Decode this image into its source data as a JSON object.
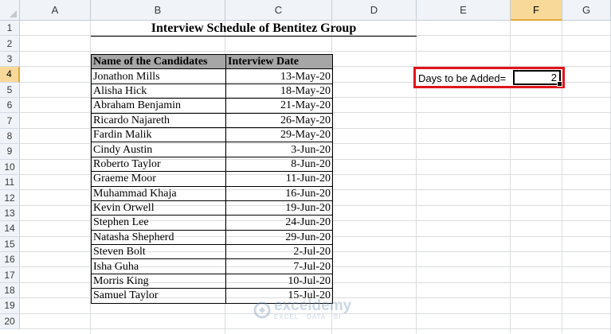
{
  "sheet": {
    "columns": [
      "A",
      "B",
      "C",
      "D",
      "E",
      "F",
      "G"
    ],
    "active_column": "F",
    "rows": [
      "1",
      "2",
      "3",
      "4",
      "5",
      "6",
      "7",
      "8",
      "9",
      "10",
      "11",
      "12",
      "13",
      "14",
      "15",
      "16",
      "17",
      "18",
      "19",
      "20"
    ],
    "active_row": "4"
  },
  "title": "Interview Schedule of Bentitez Group",
  "table": {
    "headers": [
      "Name of the Candidates",
      "Interview Date"
    ],
    "rows": [
      {
        "name": "Jonathon Mills",
        "date": "13-May-20"
      },
      {
        "name": "Alisha Hick",
        "date": "18-May-20"
      },
      {
        "name": "Abraham Benjamin",
        "date": "21-May-20"
      },
      {
        "name": "Ricardo Najareth",
        "date": "26-May-20"
      },
      {
        "name": "Fardin Malik",
        "date": "29-May-20"
      },
      {
        "name": "Cindy Austin",
        "date": "3-Jun-20"
      },
      {
        "name": "Roberto Taylor",
        "date": "8-Jun-20"
      },
      {
        "name": "Graeme Moor",
        "date": "11-Jun-20"
      },
      {
        "name": "Muhammad Khaja",
        "date": "16-Jun-20"
      },
      {
        "name": "Kevin Orwell",
        "date": "19-Jun-20"
      },
      {
        "name": "Stephen Lee",
        "date": "24-Jun-20"
      },
      {
        "name": "Natasha Shepherd",
        "date": "29-Jun-20"
      },
      {
        "name": "Steven Bolt",
        "date": "2-Jul-20"
      },
      {
        "name": "Isha Guha",
        "date": "7-Jul-20"
      },
      {
        "name": "Morris King",
        "date": "10-Jul-20"
      },
      {
        "name": "Samuel Taylor",
        "date": "15-Jul-20"
      }
    ]
  },
  "days": {
    "label": "Days to be Added=",
    "value": "2",
    "highlight_color": "#e0141b"
  },
  "watermark": {
    "name": "exceldemy",
    "tagline": "EXCEL · DATA · BI"
  },
  "colors": {
    "header_fill": "#a6a6a6",
    "active_header": "#f9d99a"
  }
}
